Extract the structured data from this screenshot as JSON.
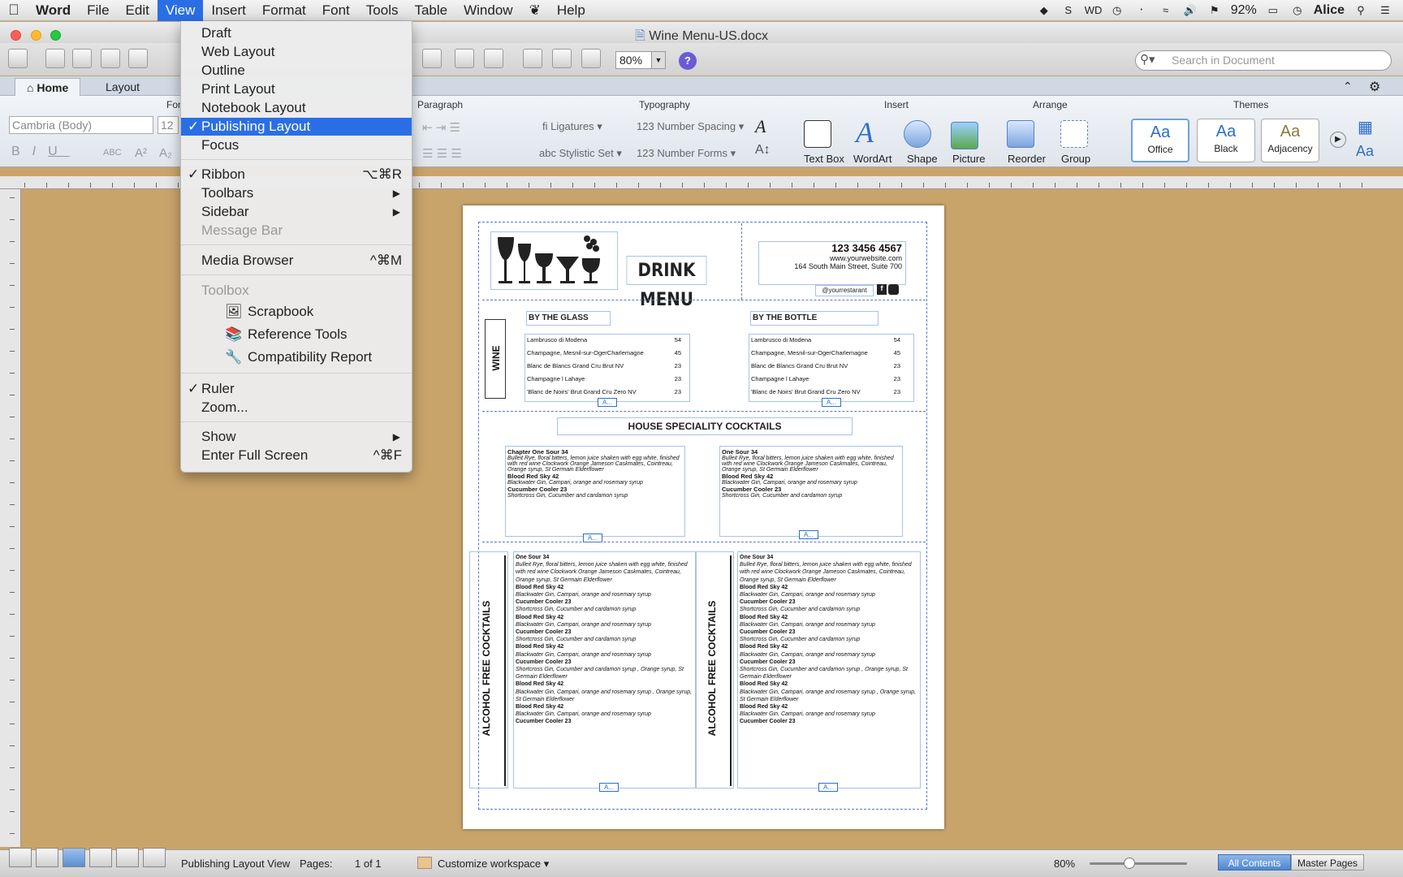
{
  "menubar": {
    "app": "Word",
    "items": [
      "File",
      "Edit",
      "View",
      "Insert",
      "Format",
      "Font",
      "Tools",
      "Table",
      "Window",
      "Help"
    ],
    "active": "View",
    "battery": "92%",
    "user": "Alice"
  },
  "window": {
    "title": "Wine Menu-US.docx"
  },
  "toolbar": {
    "zoom": "80%",
    "search_placeholder": "Search in Document"
  },
  "ribbon": {
    "tabs": [
      "Home",
      "Layout"
    ],
    "groups": {
      "font": "Font",
      "paragraph": "Paragraph",
      "typography": "Typography",
      "insert": "Insert",
      "arrange": "Arrange",
      "themes": "Themes"
    },
    "font_name": "Cambria (Body)",
    "font_size": "12",
    "typography": {
      "ligatures": "Ligatures",
      "number_spacing": "Number Spacing",
      "stylistic_set": "Stylistic Set",
      "number_forms": "Number Forms"
    },
    "insert": [
      "Text Box",
      "WordArt",
      "Shape",
      "Picture"
    ],
    "arrange": [
      "Reorder",
      "Group"
    ],
    "themes": [
      "Office",
      "Black",
      "Adjacency"
    ]
  },
  "view_menu": {
    "draft": "Draft",
    "web_layout": "Web Layout",
    "outline": "Outline",
    "print_layout": "Print Layout",
    "notebook_layout": "Notebook Layout",
    "publishing_layout": "Publishing Layout",
    "focus": "Focus",
    "ribbon": "Ribbon",
    "ribbon_sc": "⌥⌘R",
    "toolbars": "Toolbars",
    "sidebar": "Sidebar",
    "message_bar": "Message Bar",
    "media_browser": "Media Browser",
    "media_browser_sc": "^⌘M",
    "toolbox": "Toolbox",
    "scrapbook": "Scrapbook",
    "reference_tools": "Reference Tools",
    "compatibility_report": "Compatibility Report",
    "ruler": "Ruler",
    "zoom": "Zoom...",
    "show": "Show",
    "full_screen": "Enter Full Screen",
    "full_screen_sc": "^⌘F"
  },
  "document": {
    "heading": "DRINK MENU",
    "phone": "123 3456 4567",
    "website": "www.yourwebsite.com",
    "address": "164 South Main Street, Suite 700",
    "social": "@yourrestarant",
    "wine_label": "WINE",
    "by_glass": "BY THE GLASS",
    "by_bottle": "BY THE BOTTLE",
    "wines": [
      {
        "name": "Lambrusco di Modena",
        "price": "54"
      },
      {
        "name": "Champagne, Mesnil-sur-OgerCharlemagne",
        "price": "45"
      },
      {
        "name": "Blanc de Blancs Grand Cru Brut NV",
        "price": "23"
      },
      {
        "name": "Champagne l Lahaye",
        "price": "23"
      },
      {
        "name": "'Blanc de Noirs' Brut Grand Cru Zero NV",
        "price": "23"
      }
    ],
    "house_title": "HOUSE SPECIALITY COCKTAILS",
    "house_left": [
      {
        "name": "Chapter One Sour 34",
        "desc": "Bulleit Rye, floral bitters, lemon juice shaken with egg white, finished with red wine Clockwork Orange Jameson Caskmates, Cointreau, Orange syrup, St Germain Elderflower"
      },
      {
        "name": "Blood Red Sky 42",
        "desc": "Blackwater Gin, Campari, orange and rosemary syrup"
      },
      {
        "name": "Cucumber Cooler 23",
        "desc": "Shortcross Gin, Cucumber and cardamon syrup"
      }
    ],
    "house_right": [
      {
        "name": "One Sour 34",
        "desc": "Bulleit Rye, floral bitters, lemon juice shaken with egg white, finished with red wine Clockwork Orange Jameson Caskmates, Cointreau, Orange syrup, St Germain Elderflower"
      },
      {
        "name": "Blood Red Sky 42",
        "desc": "Blackwater Gin, Campari, orange and rosemary syrup"
      },
      {
        "name": "Cucumber Cooler 23",
        "desc": "Shortcross Gin, Cucumber and cardamon syrup"
      }
    ],
    "af_label": "ALCOHOL FREE COCKTAILS",
    "af_items": [
      {
        "name": "One Sour 34",
        "desc": "Bulleit Rye, floral bitters, lemon juice shaken with egg white, finished with red wine Clockwork Orange Jameson Caskmates, Cointreau, Orange syrup, St Germain Elderflower"
      },
      {
        "name": "Blood Red Sky 42",
        "desc": "Blackwater Gin, Campari, orange and rosemary syrup"
      },
      {
        "name": "Cucumber Cooler 23",
        "desc": "Shortcross Gin, Cucumber and cardamon syrup"
      },
      {
        "name": "Blood Red Sky 42",
        "desc": "Blackwater Gin, Campari, orange and rosemary syrup"
      },
      {
        "name": "Cucumber Cooler 23",
        "desc": "Shortcross Gin, Cucumber and cardamon syrup"
      },
      {
        "name": "Blood Red Sky 42",
        "desc": "Blackwater Gin, Campari, orange and rosemary syrup"
      },
      {
        "name": "Cucumber Cooler 23",
        "desc": "Shortcross Gin, Cucumber and cardamon syrup , Orange syrup, St Germain Elderflower"
      },
      {
        "name": "Blood Red Sky 42",
        "desc": "Blackwater Gin, Campari, orange and rosemary syrup , Orange syrup, St Germain Elderflower"
      },
      {
        "name": "Blood Red Sky 42",
        "desc": "Blackwater Gin, Campari, orange and rosemary syrup"
      },
      {
        "name": "Cucumber Cooler 23",
        "desc": "Shortcross Gin, Cucumber and cardamon syrup"
      }
    ],
    "textbox_tag": "A..."
  },
  "statusbar": {
    "view": "Publishing Layout View",
    "pages_label": "Pages:",
    "pages_value": "1 of 1",
    "workspace": "Customize workspace",
    "zoom": "80%",
    "all_contents": "All Contents",
    "master_pages": "Master Pages"
  },
  "colors": {
    "menu_highlight": "#2a6ee6",
    "desk": "#c9a46a",
    "textbox_border": "#a8c2e8"
  }
}
